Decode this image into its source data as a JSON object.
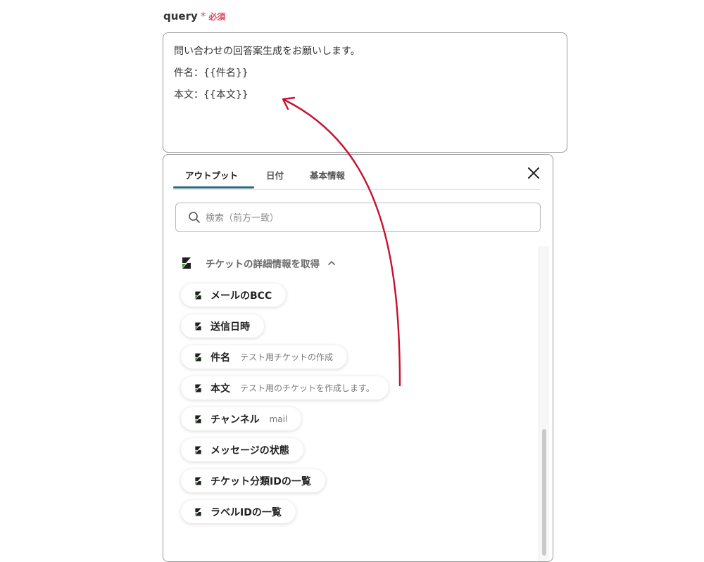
{
  "field": {
    "name": "query",
    "required_mark": "*",
    "required_text": "必須",
    "lines": [
      "問い合わせの回答案生成をお願いします。",
      "件名：{{件名}}",
      "本文：{{本文}}"
    ]
  },
  "panel": {
    "tabs": [
      {
        "label": "アウトプット",
        "active": true
      },
      {
        "label": "日付",
        "active": false
      },
      {
        "label": "基本情報",
        "active": false
      }
    ],
    "search_placeholder": "検索（前方一致）",
    "section_title": "チケットの詳細情報を取得",
    "items": [
      {
        "label": "メールのBCC",
        "value": ""
      },
      {
        "label": "送信日時",
        "value": ""
      },
      {
        "label": "件名",
        "value": "テスト用チケットの作成"
      },
      {
        "label": "本文",
        "value": "テスト用のチケットを作成します。"
      },
      {
        "label": "チャンネル",
        "value": "mail"
      },
      {
        "label": "メッセージの状態",
        "value": ""
      },
      {
        "label": "チケット分類IDの一覧",
        "value": ""
      },
      {
        "label": "ラベルIDの一覧",
        "value": ""
      }
    ]
  },
  "icons": {
    "tab_close": "close-icon",
    "search": "search-icon",
    "section_toggle": "chevron-up-icon",
    "app_logo": "zendesk-logo-icon"
  },
  "colors": {
    "required": "#e0475e",
    "tab_underline": "#2d6a7c",
    "annotation_arrow": "#c8102e",
    "logo_dark": "#1f1f1f",
    "logo_green": "#3a9a3a"
  }
}
